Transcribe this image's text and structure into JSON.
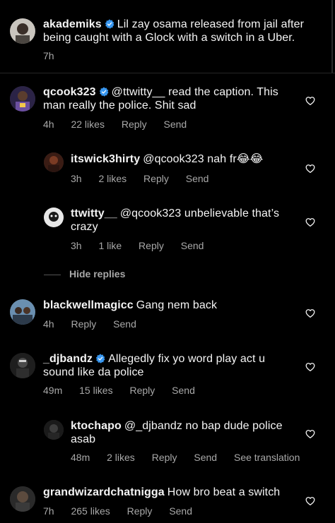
{
  "colors": {
    "background": "#000000",
    "text": "#f5f5f5",
    "muted": "#a8a8a8",
    "verified": "#3897f0",
    "divider": "#262626"
  },
  "caption": {
    "username": "akademiks",
    "verified": true,
    "text": "Lil zay osama released from jail after being caught with a Glock with a switch in a Uber.",
    "time": "7h"
  },
  "comments": [
    {
      "username": "qcook323",
      "verified": true,
      "text": "@ttwitty__ read the caption. This man really the police. Shit sad",
      "time": "4h",
      "likes": "22 likes",
      "reply": "Reply",
      "send": "Send",
      "like_icon": "heart-outline-icon"
    },
    {
      "username": "itswick3hirty",
      "verified": false,
      "text": "@qcook323 nah fr😂😂",
      "time": "3h",
      "likes": "2 likes",
      "reply": "Reply",
      "send": "Send",
      "like_icon": "heart-outline-icon"
    },
    {
      "username": "ttwitty__",
      "verified": false,
      "text": "@qcook323 unbelievable that’s crazy",
      "time": "3h",
      "likes": "1 like",
      "reply": "Reply",
      "send": "Send",
      "like_icon": "heart-outline-icon"
    },
    {
      "username": "blackwellmagicc",
      "verified": false,
      "text": "Gang nem back",
      "time": "4h",
      "reply": "Reply",
      "send": "Send",
      "like_icon": "heart-outline-icon"
    },
    {
      "username": "_djbandz",
      "verified": true,
      "text": "Allegedly fix yo word play act u sound like da police",
      "time": "49m",
      "likes": "15 likes",
      "reply": "Reply",
      "send": "Send",
      "like_icon": "heart-outline-icon"
    },
    {
      "username": "ktochapo",
      "verified": false,
      "text": "@_djbandz no bap dude police asab",
      "time": "48m",
      "likes": "2 likes",
      "reply": "Reply",
      "send": "Send",
      "translation": "See translation",
      "like_icon": "heart-outline-icon"
    },
    {
      "username": "grandwizardchatnigga",
      "verified": false,
      "text": "How bro beat a switch",
      "time": "7h",
      "likes": "265 likes",
      "reply": "Reply",
      "send": "Send",
      "like_icon": "heart-outline-icon"
    }
  ],
  "hide_replies": "Hide replies"
}
